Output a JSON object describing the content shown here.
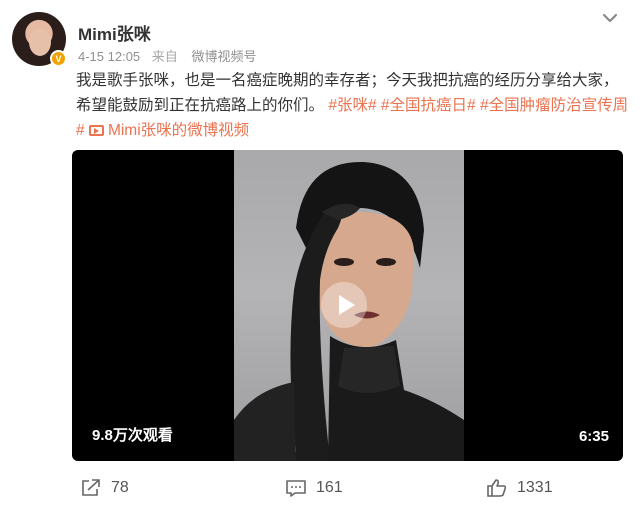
{
  "user": {
    "name": "Mimi张咪",
    "avatar_icon": "avatar-photo",
    "verified_badge": "V"
  },
  "meta": {
    "time": "4-15 12:05",
    "source_label": "来自",
    "source": "微博视频号"
  },
  "post": {
    "text": "我是歌手张咪，也是一名癌症晚期的幸存者；今天我把抗癌的经历分享给大家，希望能鼓励到正在抗癌路上的你们。",
    "tags": [
      "#张咪#",
      "#全国抗癌日#",
      "#全国肿瘤防治宣传周#"
    ],
    "video_link": "Mimi张咪的微博视频"
  },
  "video": {
    "views": "9.8万次观看",
    "duration": "6:35",
    "play_icon": "play-icon"
  },
  "actions": {
    "share_count": "78",
    "comment_count": "161",
    "like_count": "1331"
  },
  "colors": {
    "accent": "#eb7350",
    "video_bg": "#000000",
    "verified": "#f2a200"
  }
}
